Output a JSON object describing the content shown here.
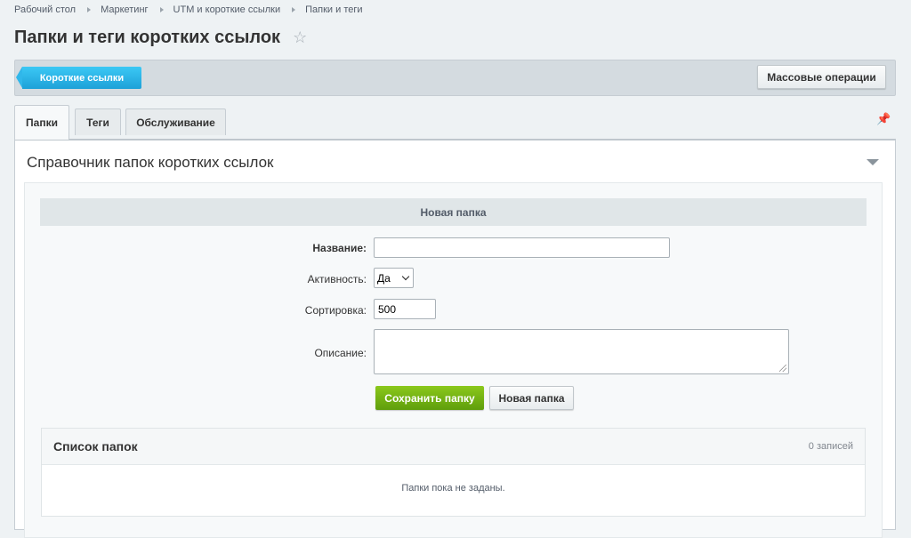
{
  "breadcrumb": [
    "Рабочий стол",
    "Маркетинг",
    "UTM и короткие ссылки",
    "Папки и теги"
  ],
  "page_title": "Папки и теги коротких ссылок",
  "toolbar": {
    "short_links_label": "Короткие ссылки",
    "mass_operations_label": "Массовые операции"
  },
  "tabs": [
    {
      "label": "Папки",
      "active": true
    },
    {
      "label": "Теги",
      "active": false
    },
    {
      "label": "Обслуживание",
      "active": false
    }
  ],
  "panel": {
    "title": "Справочник папок коротких ссылок",
    "form_header": "Новая папка",
    "fields": {
      "name_label": "Название:",
      "name_value": "",
      "active_label": "Активность:",
      "active_value": "Да",
      "sort_label": "Сортировка:",
      "sort_value": "500",
      "description_label": "Описание:",
      "description_value": ""
    },
    "save_button": "Сохранить папку",
    "new_button": "Новая папка",
    "list": {
      "title": "Список папок",
      "count": "0 записей",
      "empty_text": "Папки пока не заданы."
    }
  },
  "colors": {
    "accent_blue": "#1ea1d8",
    "save_green": "#6fae12",
    "background": "#eef2f4"
  }
}
